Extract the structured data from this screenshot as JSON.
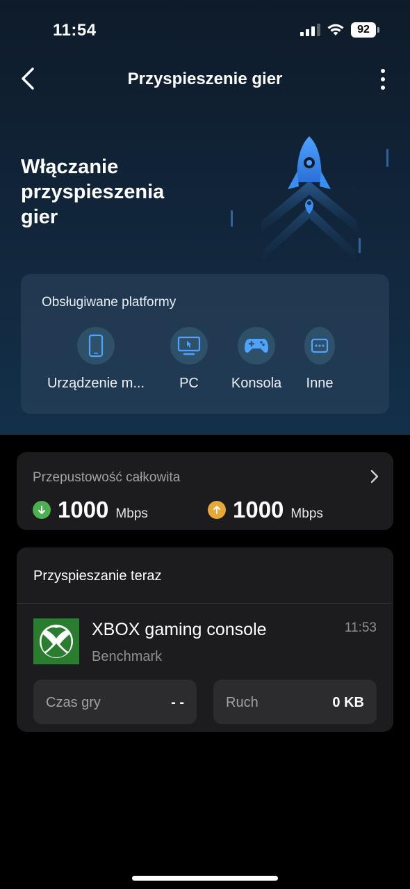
{
  "status_bar": {
    "time": "11:54",
    "battery": "92"
  },
  "nav": {
    "title": "Przyspieszenie gier"
  },
  "hero": {
    "title": "Włączanie przyspieszenia gier"
  },
  "platforms": {
    "label": "Obsługiwane platformy",
    "items": [
      {
        "label": "Urządzenie m...",
        "icon": "phone-icon"
      },
      {
        "label": "PC",
        "icon": "monitor-icon"
      },
      {
        "label": "Konsola",
        "icon": "gamepad-icon"
      },
      {
        "label": "Inne",
        "icon": "more-icon"
      }
    ]
  },
  "bandwidth": {
    "title": "Przepustowość całkowita",
    "download": {
      "value": "1000",
      "unit": "Mbps",
      "color": "#4caf50"
    },
    "upload": {
      "value": "1000",
      "unit": "Mbps",
      "color": "#e8a838"
    }
  },
  "accelerating": {
    "title": "Przyspieszanie teraz",
    "device": {
      "name": "XBOX gaming console",
      "subtitle": "Benchmark",
      "time": "11:53"
    },
    "stats": [
      {
        "label": "Czas gry",
        "value": "- -"
      },
      {
        "label": "Ruch",
        "value": "0 KB"
      }
    ]
  },
  "colors": {
    "accent": "#4a9df0",
    "card": "#1c1c1e",
    "xbox_green": "#2a7d2e"
  }
}
